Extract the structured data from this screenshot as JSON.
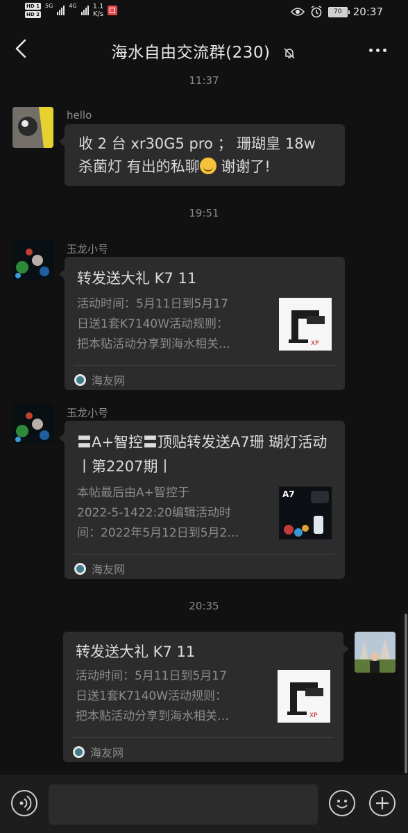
{
  "status_bar": {
    "hd1": "HD 1",
    "hd2": "HD 2",
    "net1": "5G",
    "net2": "4G",
    "speed_value": "1.1",
    "speed_unit": "K/s",
    "battery": "70",
    "time": "20:37"
  },
  "header": {
    "title": "海水自由交流群(230)"
  },
  "messages": [
    {
      "timestamp": "11:37",
      "sender": "hello",
      "text_before_emoji": "收 2 台 xr30G5 pro  ；  珊瑚皇 18w 杀菌灯 有出的私聊",
      "text_after_emoji": " 谢谢了!"
    },
    {
      "timestamp": "19:51",
      "sender": "玉龙小号",
      "card": {
        "title": "转发送大礼 K7 11",
        "desc_lines": [
          "活动时间：5月11日到5月17",
          "日送1套K7140W活动规则：",
          "把本贴活动分享到海水相关…"
        ],
        "source": "海友网"
      }
    },
    {
      "sender": "玉龙小号",
      "card": {
        "title": "〓A+智控〓顶贴转发送A7珊 瑚灯活动丨第2207期丨",
        "desc_lines": [
          "本帖最后由A+智控于",
          "2022-5-1422:20编辑活动时",
          "间：2022年5月12日到5月2…"
        ],
        "source": "海友网",
        "thumb_label": "A7"
      }
    },
    {
      "timestamp": "20:35",
      "card": {
        "title": "转发送大礼 K7 11",
        "desc_lines": [
          "活动时间：5月11日到5月17",
          "日送1套K7140W活动规则：",
          "把本贴活动分享到海水相关…"
        ],
        "source": "海友网"
      }
    }
  ],
  "input": {
    "placeholder": ""
  },
  "colors": {
    "background": "#111111",
    "bubble": "#2c2c2c",
    "text": "#d8d8d8",
    "muted": "#8c8c8c"
  }
}
